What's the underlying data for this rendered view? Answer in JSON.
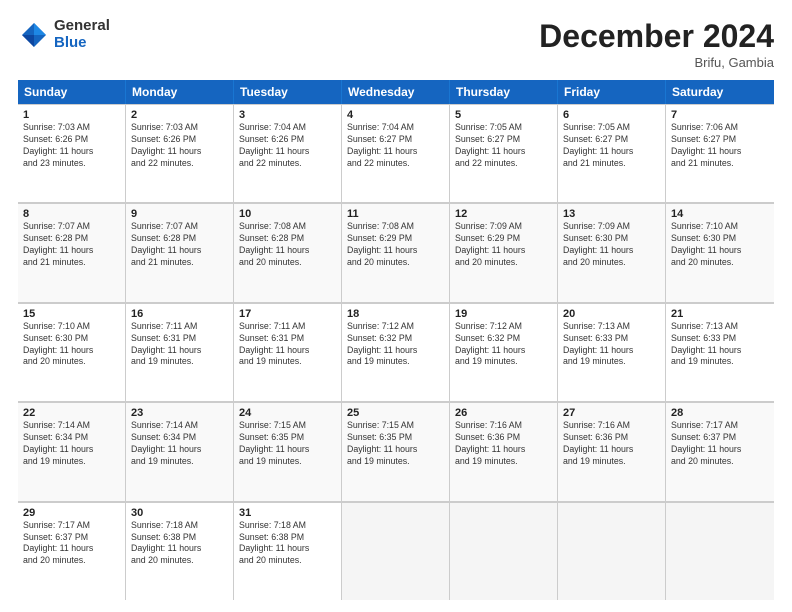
{
  "logo": {
    "general": "General",
    "blue": "Blue"
  },
  "title": "December 2024",
  "location": "Brifu, Gambia",
  "days": [
    "Sunday",
    "Monday",
    "Tuesday",
    "Wednesday",
    "Thursday",
    "Friday",
    "Saturday"
  ],
  "rows": [
    [
      {
        "day": "1",
        "info": "Sunrise: 7:03 AM\nSunset: 6:26 PM\nDaylight: 11 hours\nand 23 minutes."
      },
      {
        "day": "2",
        "info": "Sunrise: 7:03 AM\nSunset: 6:26 PM\nDaylight: 11 hours\nand 22 minutes."
      },
      {
        "day": "3",
        "info": "Sunrise: 7:04 AM\nSunset: 6:26 PM\nDaylight: 11 hours\nand 22 minutes."
      },
      {
        "day": "4",
        "info": "Sunrise: 7:04 AM\nSunset: 6:27 PM\nDaylight: 11 hours\nand 22 minutes."
      },
      {
        "day": "5",
        "info": "Sunrise: 7:05 AM\nSunset: 6:27 PM\nDaylight: 11 hours\nand 22 minutes."
      },
      {
        "day": "6",
        "info": "Sunrise: 7:05 AM\nSunset: 6:27 PM\nDaylight: 11 hours\nand 21 minutes."
      },
      {
        "day": "7",
        "info": "Sunrise: 7:06 AM\nSunset: 6:27 PM\nDaylight: 11 hours\nand 21 minutes."
      }
    ],
    [
      {
        "day": "8",
        "info": "Sunrise: 7:07 AM\nSunset: 6:28 PM\nDaylight: 11 hours\nand 21 minutes."
      },
      {
        "day": "9",
        "info": "Sunrise: 7:07 AM\nSunset: 6:28 PM\nDaylight: 11 hours\nand 21 minutes."
      },
      {
        "day": "10",
        "info": "Sunrise: 7:08 AM\nSunset: 6:28 PM\nDaylight: 11 hours\nand 20 minutes."
      },
      {
        "day": "11",
        "info": "Sunrise: 7:08 AM\nSunset: 6:29 PM\nDaylight: 11 hours\nand 20 minutes."
      },
      {
        "day": "12",
        "info": "Sunrise: 7:09 AM\nSunset: 6:29 PM\nDaylight: 11 hours\nand 20 minutes."
      },
      {
        "day": "13",
        "info": "Sunrise: 7:09 AM\nSunset: 6:30 PM\nDaylight: 11 hours\nand 20 minutes."
      },
      {
        "day": "14",
        "info": "Sunrise: 7:10 AM\nSunset: 6:30 PM\nDaylight: 11 hours\nand 20 minutes."
      }
    ],
    [
      {
        "day": "15",
        "info": "Sunrise: 7:10 AM\nSunset: 6:30 PM\nDaylight: 11 hours\nand 20 minutes."
      },
      {
        "day": "16",
        "info": "Sunrise: 7:11 AM\nSunset: 6:31 PM\nDaylight: 11 hours\nand 19 minutes."
      },
      {
        "day": "17",
        "info": "Sunrise: 7:11 AM\nSunset: 6:31 PM\nDaylight: 11 hours\nand 19 minutes."
      },
      {
        "day": "18",
        "info": "Sunrise: 7:12 AM\nSunset: 6:32 PM\nDaylight: 11 hours\nand 19 minutes."
      },
      {
        "day": "19",
        "info": "Sunrise: 7:12 AM\nSunset: 6:32 PM\nDaylight: 11 hours\nand 19 minutes."
      },
      {
        "day": "20",
        "info": "Sunrise: 7:13 AM\nSunset: 6:33 PM\nDaylight: 11 hours\nand 19 minutes."
      },
      {
        "day": "21",
        "info": "Sunrise: 7:13 AM\nSunset: 6:33 PM\nDaylight: 11 hours\nand 19 minutes."
      }
    ],
    [
      {
        "day": "22",
        "info": "Sunrise: 7:14 AM\nSunset: 6:34 PM\nDaylight: 11 hours\nand 19 minutes."
      },
      {
        "day": "23",
        "info": "Sunrise: 7:14 AM\nSunset: 6:34 PM\nDaylight: 11 hours\nand 19 minutes."
      },
      {
        "day": "24",
        "info": "Sunrise: 7:15 AM\nSunset: 6:35 PM\nDaylight: 11 hours\nand 19 minutes."
      },
      {
        "day": "25",
        "info": "Sunrise: 7:15 AM\nSunset: 6:35 PM\nDaylight: 11 hours\nand 19 minutes."
      },
      {
        "day": "26",
        "info": "Sunrise: 7:16 AM\nSunset: 6:36 PM\nDaylight: 11 hours\nand 19 minutes."
      },
      {
        "day": "27",
        "info": "Sunrise: 7:16 AM\nSunset: 6:36 PM\nDaylight: 11 hours\nand 19 minutes."
      },
      {
        "day": "28",
        "info": "Sunrise: 7:17 AM\nSunset: 6:37 PM\nDaylight: 11 hours\nand 20 minutes."
      }
    ],
    [
      {
        "day": "29",
        "info": "Sunrise: 7:17 AM\nSunset: 6:37 PM\nDaylight: 11 hours\nand 20 minutes."
      },
      {
        "day": "30",
        "info": "Sunrise: 7:18 AM\nSunset: 6:38 PM\nDaylight: 11 hours\nand 20 minutes."
      },
      {
        "day": "31",
        "info": "Sunrise: 7:18 AM\nSunset: 6:38 PM\nDaylight: 11 hours\nand 20 minutes."
      },
      {
        "day": "",
        "info": ""
      },
      {
        "day": "",
        "info": ""
      },
      {
        "day": "",
        "info": ""
      },
      {
        "day": "",
        "info": ""
      }
    ]
  ]
}
